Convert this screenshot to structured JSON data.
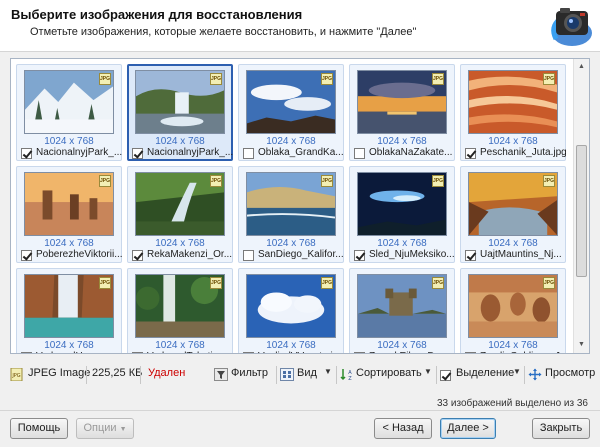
{
  "header": {
    "title": "Выберите изображения для восстановления",
    "subtitle": "Отметьте изображения, которые желаете восстановить, и нажмите \"Далее\""
  },
  "grid": {
    "badge_text": "JPG",
    "rows": [
      [
        {
          "name": "NacionalnyjPark_...",
          "dims": "1024 x 768",
          "checked": true,
          "selected": false,
          "scene": "snow"
        },
        {
          "name": "NacionalnyjPark_...",
          "dims": "1024 x 768",
          "checked": true,
          "selected": true,
          "scene": "waterfall"
        },
        {
          "name": "Oblaka_GrandKa...",
          "dims": "1024 x 768",
          "checked": false,
          "selected": false,
          "scene": "sky"
        },
        {
          "name": "OblakaNaZakate...",
          "dims": "1024 x 768",
          "checked": false,
          "selected": false,
          "scene": "sunset"
        },
        {
          "name": "Peschanik_Juta.jpg",
          "dims": "1024 x 768",
          "checked": true,
          "selected": false,
          "scene": "sandstone"
        }
      ],
      [
        {
          "name": "PoberezheViktorii...",
          "dims": "1024 x 768",
          "checked": true,
          "selected": false,
          "scene": "coast"
        },
        {
          "name": "RekaMakenzi_Or...",
          "dims": "1024 x 768",
          "checked": true,
          "selected": false,
          "scene": "forest"
        },
        {
          "name": "SanDiego_Kalifor...",
          "dims": "1024 x 768",
          "checked": false,
          "selected": false,
          "scene": "shore"
        },
        {
          "name": "Sled_NjuMeksiko...",
          "dims": "1024 x 768",
          "checked": true,
          "selected": false,
          "scene": "night"
        },
        {
          "name": "UajtMauntins_Nj...",
          "dims": "1024 x 768",
          "checked": true,
          "selected": false,
          "scene": "autumn"
        }
      ],
      [
        {
          "name": "VodopadHavasu_...",
          "dims": "1024 x 768",
          "checked": true,
          "selected": false,
          "scene": "canyon"
        },
        {
          "name": "VodopadToketi_...",
          "dims": "1024 x 768",
          "checked": true,
          "selected": false,
          "scene": "jungle"
        },
        {
          "name": "VzgljadVVysotu.jpg",
          "dims": "1024 x 768",
          "checked": true,
          "selected": false,
          "scene": "clouds"
        },
        {
          "name": "ZamokEileanDona...",
          "dims": "1024 x 768",
          "checked": true,
          "selected": false,
          "scene": "castle"
        },
        {
          "name": "ZemljaGoblinov_J...",
          "dims": "1024 x 768",
          "checked": true,
          "selected": false,
          "scene": "goblin"
        }
      ]
    ]
  },
  "toolbar": {
    "file_type": "JPEG Image",
    "file_size": "225,25 КБ",
    "status": "Удален",
    "status_color": "#cc0000",
    "filter_label": "Фильтр",
    "view_label": "Вид",
    "sort_label": "Сортировать",
    "selection_label": "Выделение",
    "preview_label": "Просмотр"
  },
  "status_bar": {
    "selection_count": "33 изображений выделено из 36"
  },
  "buttons": {
    "help": "Помощь",
    "options": "Опции",
    "back": "< Назад",
    "next": "Далее >",
    "close": "Закрыть"
  },
  "icons": {
    "logo": "camera-recovery-icon",
    "file": "jpeg-file-icon",
    "filter": "filter-icon",
    "view": "view-icon",
    "sort": "sort-icon",
    "preview": "preview-icon"
  }
}
